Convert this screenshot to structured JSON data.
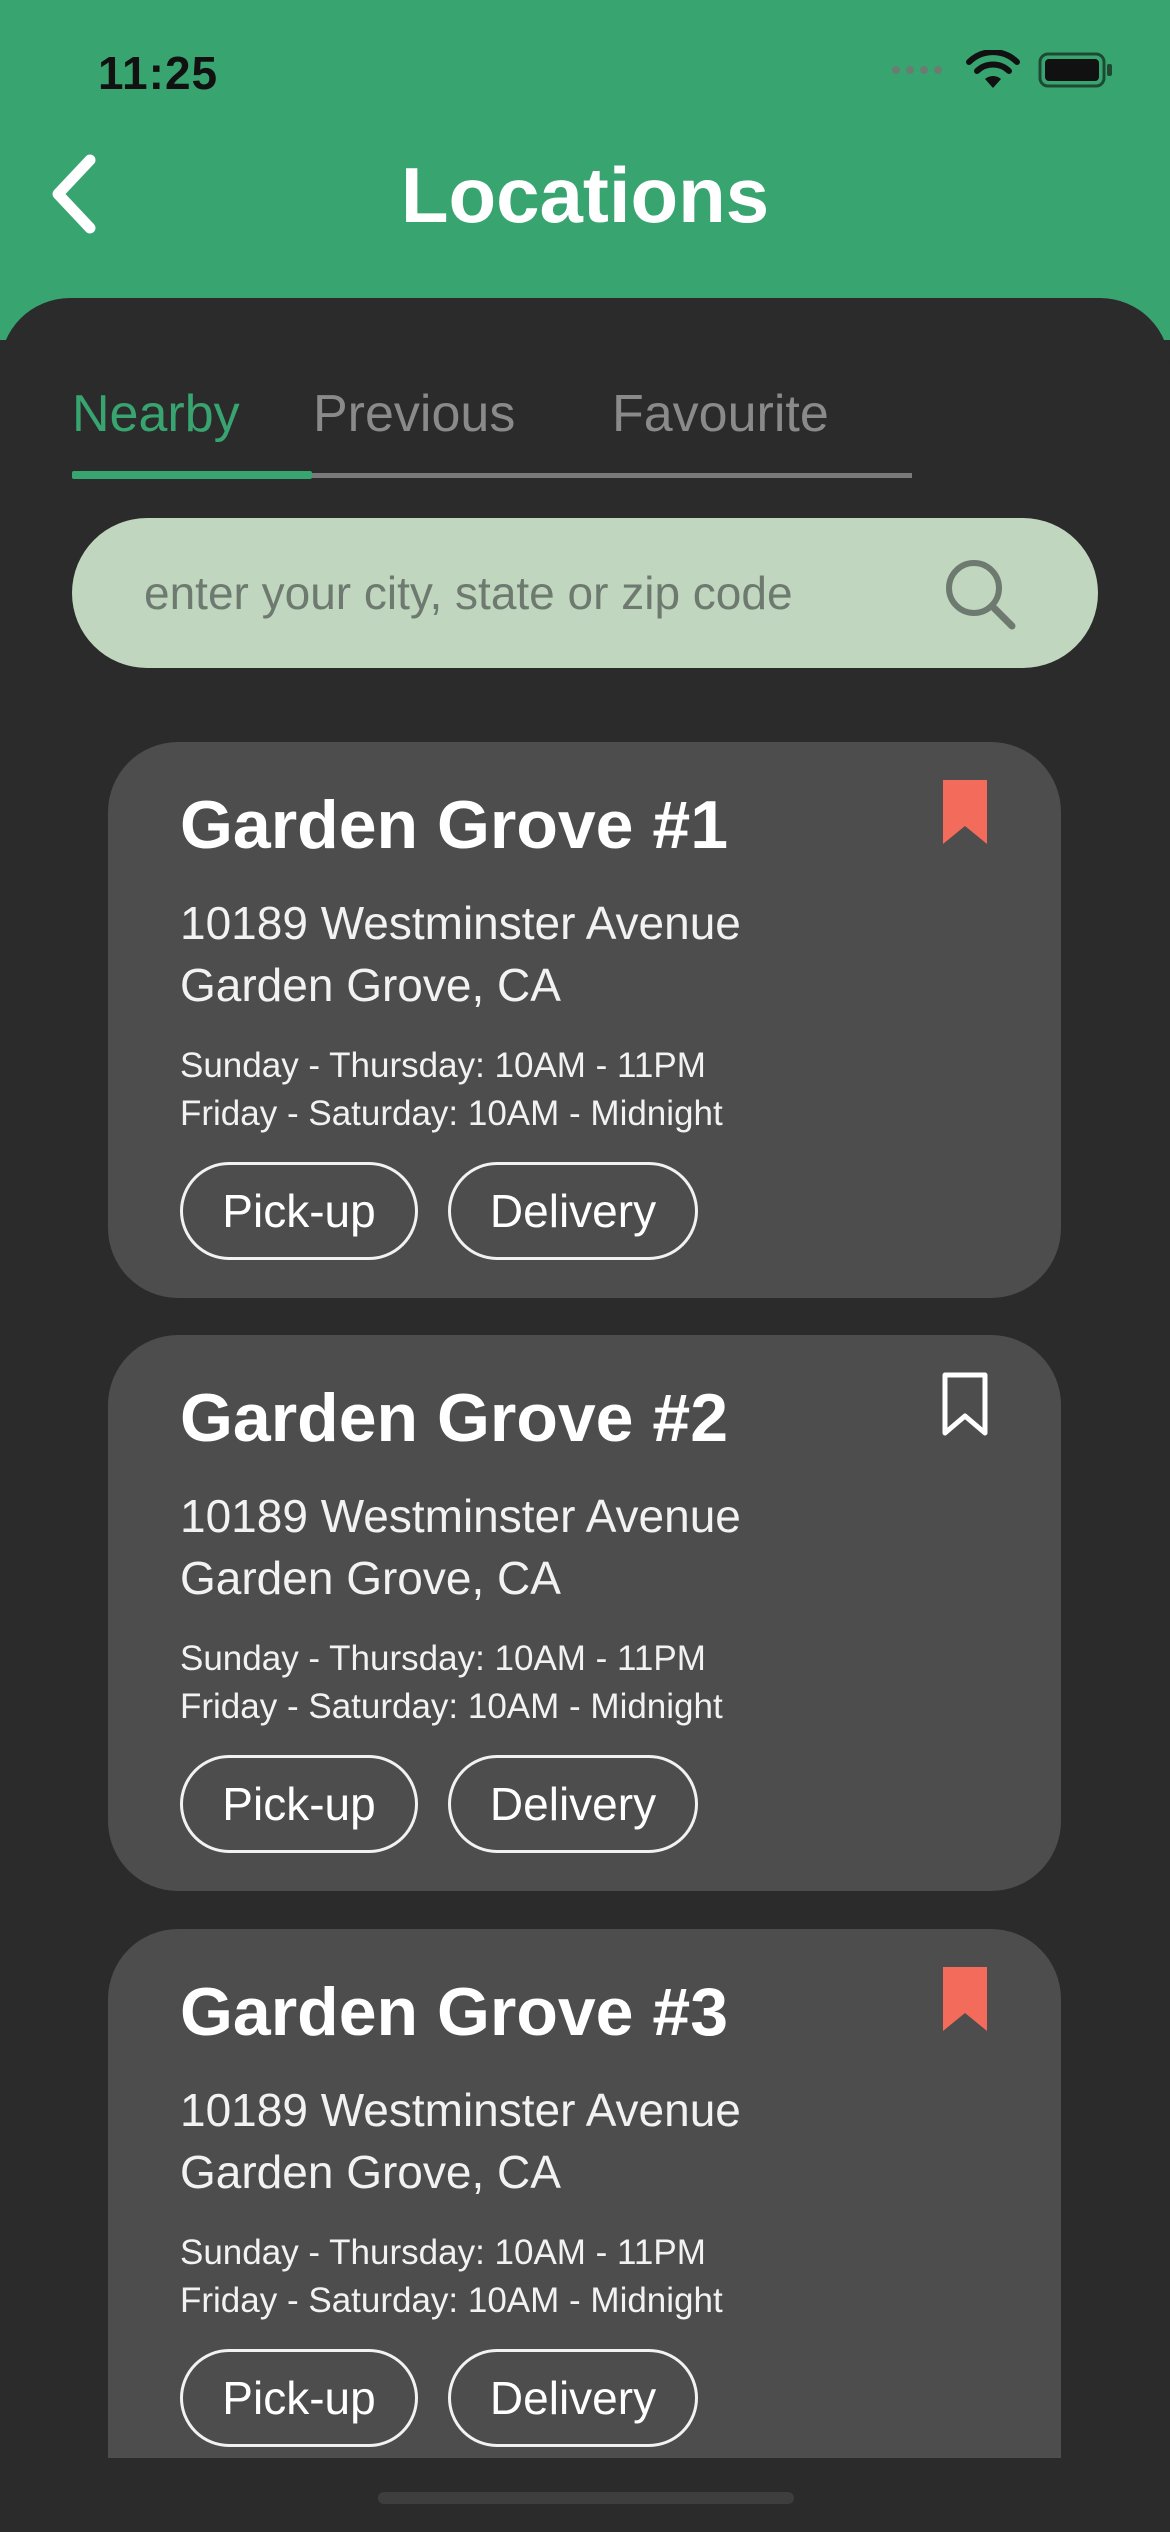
{
  "status_bar": {
    "time": "11:25"
  },
  "header": {
    "title": "Locations"
  },
  "tabs": [
    {
      "label": "Nearby",
      "active": true
    },
    {
      "label": "Previous",
      "active": false
    },
    {
      "label": "Favourite",
      "active": false
    }
  ],
  "search": {
    "placeholder": "enter your city, state or zip code",
    "value": ""
  },
  "locations": [
    {
      "name": "Garden Grove #1",
      "address_line1": "10189 Westminster Avenue",
      "address_line2": "Garden Grove, CA",
      "hours_line1": "Sunday - Thursday: 10AM - 11PM",
      "hours_line2": "Friday - Saturday: 10AM - Midnight",
      "pickup_label": "Pick-up",
      "delivery_label": "Delivery",
      "bookmarked": true
    },
    {
      "name": "Garden Grove #2",
      "address_line1": "10189 Westminster Avenue",
      "address_line2": "Garden Grove, CA",
      "hours_line1": "Sunday - Thursday: 10AM - 11PM",
      "hours_line2": "Friday - Saturday: 10AM - Midnight",
      "pickup_label": "Pick-up",
      "delivery_label": "Delivery",
      "bookmarked": false
    },
    {
      "name": "Garden Grove #3",
      "address_line1": "10189 Westminster Avenue",
      "address_line2": "Garden Grove, CA",
      "hours_line1": "Sunday - Thursday: 10AM - 11PM",
      "hours_line2": "Friday - Saturday: 10AM - Midnight",
      "pickup_label": "Pick-up",
      "delivery_label": "Delivery",
      "bookmarked": true
    }
  ],
  "colors": {
    "brand_green": "#38a571",
    "panel_background": "#2b2b2b",
    "card_background": "#4d4d4d",
    "search_background": "#c0d6be",
    "bookmark_active": "#f26b5b"
  },
  "icons": {
    "back": "chevron-left-icon",
    "search": "search-icon",
    "bookmark_filled": "bookmark-filled-icon",
    "bookmark_outline": "bookmark-outline-icon"
  }
}
